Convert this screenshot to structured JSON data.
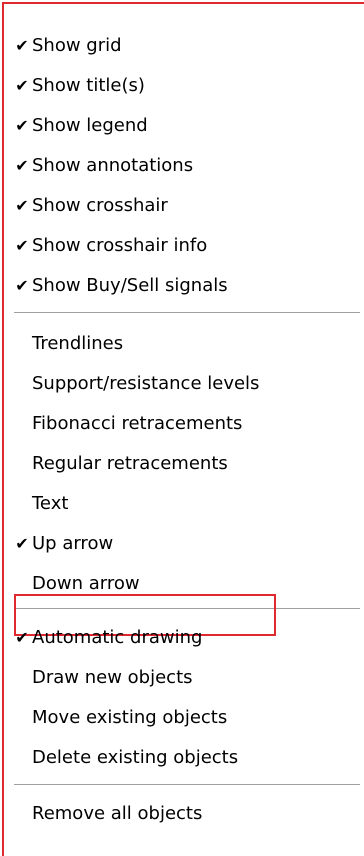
{
  "menu": {
    "group1": [
      {
        "label": "Show grid",
        "checked": true
      },
      {
        "label": "Show title(s)",
        "checked": true
      },
      {
        "label": "Show legend",
        "checked": true
      },
      {
        "label": "Show annotations",
        "checked": true
      },
      {
        "label": "Show crosshair",
        "checked": true
      },
      {
        "label": "Show crosshair info",
        "checked": true
      },
      {
        "label": "Show Buy/Sell signals",
        "checked": true
      }
    ],
    "group2": [
      {
        "label": "Trendlines",
        "checked": false
      },
      {
        "label": "Support/resistance levels",
        "checked": false
      },
      {
        "label": "Fibonacci retracements",
        "checked": false
      },
      {
        "label": "Regular retracements",
        "checked": false
      },
      {
        "label": "Text",
        "checked": false
      },
      {
        "label": "Up arrow",
        "checked": true
      },
      {
        "label": "Down arrow",
        "checked": false
      }
    ],
    "group3": [
      {
        "label": "Automatic drawing",
        "checked": true
      },
      {
        "label": "Draw new objects",
        "checked": false
      },
      {
        "label": "Move existing objects",
        "checked": false
      },
      {
        "label": "Delete existing objects",
        "checked": false
      }
    ],
    "group4": [
      {
        "label": "Remove all objects",
        "checked": false
      }
    ],
    "checkmark_glyph": "✔",
    "accent_color": "#e0282f"
  }
}
